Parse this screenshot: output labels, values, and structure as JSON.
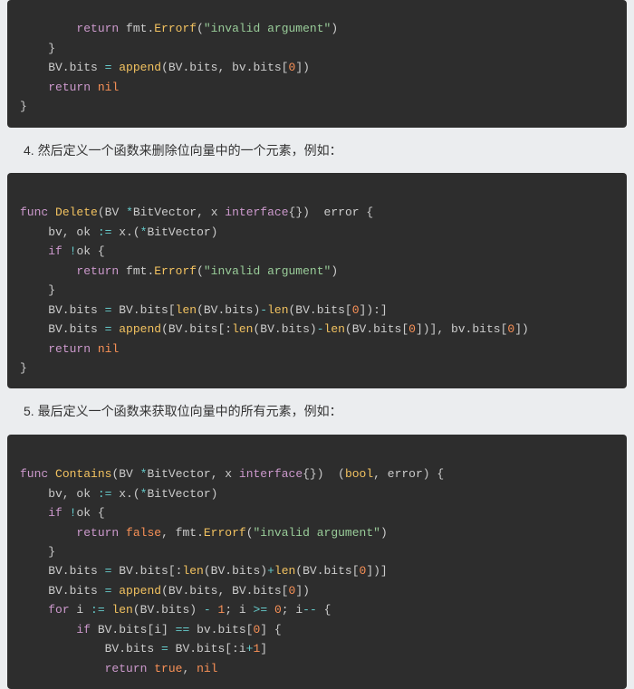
{
  "step4_text": "4. 然后定义一个函数来删除位向量中的一个元素，例如：",
  "step5_text": "5. 最后定义一个函数来获取位向量中的所有元素，例如：",
  "code1": {
    "l1a": "        ",
    "l1b": "return",
    "l1c": " fmt.",
    "l1d": "Errorf",
    "l1e": "(",
    "l1f": "\"invalid argument\"",
    "l1g": ")",
    "l2": "    }",
    "l3a": "    BV.bits ",
    "l3b": "=",
    "l3c": " ",
    "l3d": "append",
    "l3e": "(BV.bits, bv.bits[",
    "l3f": "0",
    "l3g": "])",
    "l4a": "    ",
    "l4b": "return",
    "l4c": " ",
    "l4d": "nil",
    "l5": "}"
  },
  "code2": {
    "l1a": "func",
    "l1b": " ",
    "l1c": "Delete",
    "l1d": "(BV ",
    "l1e": "*",
    "l1f": "BitVector, x ",
    "l1g": "interface",
    "l1h": "{}) ",
    "l1i": " error {",
    "l2a": "    bv, ok ",
    "l2b": ":=",
    "l2c": " x.(",
    "l2d": "*",
    "l2e": "BitVector)",
    "l3a": "    ",
    "l3b": "if",
    "l3c": " ",
    "l3d": "!",
    "l3e": "ok {",
    "l4a": "        ",
    "l4b": "return",
    "l4c": " fmt.",
    "l4d": "Errorf",
    "l4e": "(",
    "l4f": "\"invalid argument\"",
    "l4g": ")",
    "l5": "    }",
    "l6a": "    BV.bits ",
    "l6b": "=",
    "l6c": " BV.bits[",
    "l6d": "len",
    "l6e": "(BV.bits)",
    "l6f": "-",
    "l6g": "len",
    "l6h": "(BV.bits[",
    "l6i": "0",
    "l6j": "]):]",
    "l7a": "    BV.bits ",
    "l7b": "=",
    "l7c": " ",
    "l7d": "append",
    "l7e": "(BV.bits[:",
    "l7f": "len",
    "l7g": "(BV.bits)",
    "l7h": "-",
    "l7i": "len",
    "l7j": "(BV.bits[",
    "l7k": "0",
    "l7l": "])], bv.bits[",
    "l7m": "0",
    "l7n": "])",
    "l8a": "    ",
    "l8b": "return",
    "l8c": " ",
    "l8d": "nil",
    "l9": "}"
  },
  "code3": {
    "l1a": "func",
    "l1b": " ",
    "l1c": "Contains",
    "l1d": "(BV ",
    "l1e": "*",
    "l1f": "BitVector, x ",
    "l1g": "interface",
    "l1h": "{}) ",
    "l1i": " (",
    "l1j": "bool",
    "l1k": ", error) {",
    "l2a": "    bv, ok ",
    "l2b": ":=",
    "l2c": " x.(",
    "l2d": "*",
    "l2e": "BitVector)",
    "l3a": "    ",
    "l3b": "if",
    "l3c": " ",
    "l3d": "!",
    "l3e": "ok {",
    "l4a": "        ",
    "l4b": "return",
    "l4c": " ",
    "l4d": "false",
    "l4e": ", fmt.",
    "l4f": "Errorf",
    "l4g": "(",
    "l4h": "\"invalid argument\"",
    "l4i": ")",
    "l5": "    }",
    "l6a": "    BV.bits ",
    "l6b": "=",
    "l6c": " BV.bits[:",
    "l6d": "len",
    "l6e": "(BV.bits)",
    "l6f": "+",
    "l6g": "len",
    "l6h": "(BV.bits[",
    "l6i": "0",
    "l6j": "])]",
    "l7a": "    BV.bits ",
    "l7b": "=",
    "l7c": " ",
    "l7d": "append",
    "l7e": "(BV.bits, BV.bits[",
    "l7f": "0",
    "l7g": "])",
    "l8a": "    ",
    "l8b": "for",
    "l8c": " i ",
    "l8d": ":=",
    "l8e": " ",
    "l8f": "len",
    "l8g": "(BV.bits) ",
    "l8h": "-",
    "l8i": " ",
    "l8j": "1",
    "l8k": "; i ",
    "l8l": ">=",
    "l8m": " ",
    "l8n": "0",
    "l8o": "; i",
    "l8p": "--",
    "l8q": " {",
    "l9a": "        ",
    "l9b": "if",
    "l9c": " BV.bits[i] ",
    "l9d": "==",
    "l9e": " bv.bits[",
    "l9f": "0",
    "l9g": "] {",
    "l10a": "            BV.bits ",
    "l10b": "=",
    "l10c": " BV.bits[:i",
    "l10d": "+",
    "l10e": "1",
    "l10f": "]",
    "l11a": "            ",
    "l11b": "return",
    "l11c": " ",
    "l11d": "true",
    "l11e": ", ",
    "l11f": "nil"
  }
}
